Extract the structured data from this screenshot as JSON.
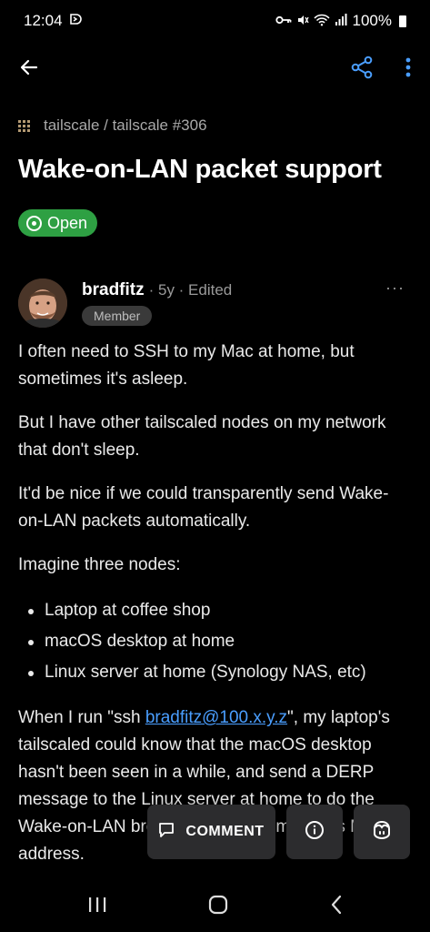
{
  "status_bar": {
    "time": "12:04",
    "battery": "100%"
  },
  "app_bar": {
    "icons": [
      "back-arrow-icon",
      "share-icon",
      "more-vertical-icon"
    ]
  },
  "breadcrumb": {
    "text": "tailscale / tailscale #306"
  },
  "issue": {
    "title": "Wake-on-LAN packet support",
    "state": "Open",
    "state_color": "#2ea043"
  },
  "comment": {
    "author": "bradfitz",
    "meta": "· 5y · Edited",
    "role": "Member",
    "more": "···",
    "paragraphs": [
      "I often need to SSH to my Mac at home, but sometimes it's asleep.",
      "But I have other tailscaled nodes on my network that don't sleep.",
      "It'd be nice if we could transparently send Wake-on-LAN packets automatically.",
      "Imagine three nodes:"
    ],
    "list_items": [
      "Laptop at coffee shop",
      "macOS desktop at home",
      "Linux server at home (Synology NAS, etc)"
    ],
    "last_para_prefix": "When I run \"ssh ",
    "last_para_link": "bradfitz@100.x.y.z",
    "last_para_suffix": "\", my laptop's tailscaled could know that the macOS desktop hasn't been seen in a while, and send a DERP message to the Linux server at home to do the Wake-on-LAN broadcast with the macOS's MAC address."
  },
  "actions": {
    "comment_label": "COMMENT"
  },
  "colors": {
    "link": "#4a9eff",
    "background": "#000000",
    "fab": "#2c2c2e"
  }
}
